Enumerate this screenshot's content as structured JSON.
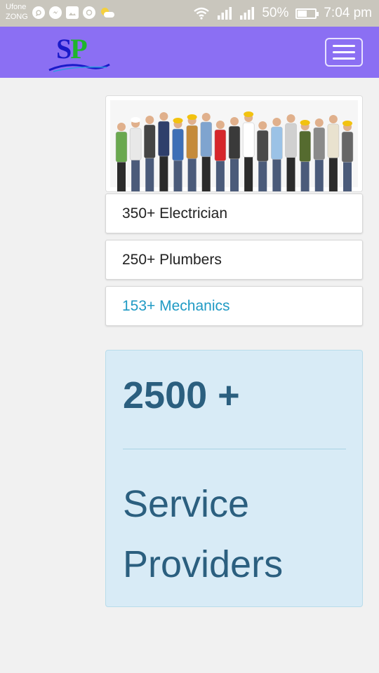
{
  "status_bar": {
    "carrier_1": "Ufone",
    "carrier_2": "ZONG",
    "battery_text": "50%",
    "battery_level": 0.5,
    "time": "7:04 pm",
    "icons": [
      "whatsapp-icon",
      "messenger-icon",
      "gallery-icon",
      "sync-icon",
      "weather-icon",
      "wifi-icon",
      "signal-icon",
      "signal-icon",
      "battery-icon"
    ]
  },
  "navbar": {
    "logo_text_s": "S",
    "logo_text_p": "P",
    "toggler_icon": "hamburger-menu-icon",
    "background": "#8b6ff3"
  },
  "categories": [
    {
      "label": "350+ Electrician",
      "active": false
    },
    {
      "label": "250+ Plumbers",
      "active": false
    },
    {
      "label": "153+ Mechanics",
      "active": true
    }
  ],
  "stats": {
    "number": "2500 +",
    "label_line_1": "Service",
    "label_line_2": "Providers"
  },
  "colors": {
    "accent": "#1f9ac4",
    "stats_bg": "#d8ebf6",
    "stats_text": "#2b5f7f"
  }
}
